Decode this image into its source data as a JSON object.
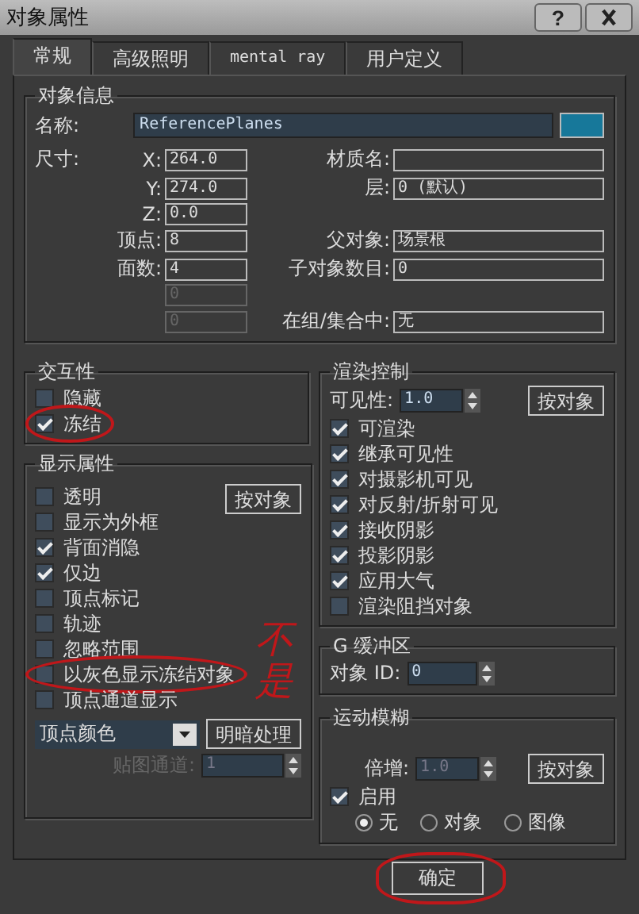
{
  "window": {
    "title": "对象属性",
    "help_button": "?"
  },
  "tabs": [
    {
      "label": "常规",
      "selected": true
    },
    {
      "label": "高级照明",
      "selected": false
    },
    {
      "label": "mental ray",
      "selected": false
    },
    {
      "label": "用户定义",
      "selected": false
    }
  ],
  "object_info": {
    "title": "对象信息",
    "name_label": "名称:",
    "name_value": "ReferencePlanes",
    "size_label": "尺寸:",
    "rows": [
      {
        "left": {
          "label": "X:",
          "value": "264.0"
        },
        "right": {
          "label": "材质名:"
        }
      },
      {
        "left": {
          "label": "Y:",
          "value": "274.0"
        },
        "right": {
          "label": "层:",
          "value": "0 (默认)"
        }
      },
      {
        "left": {
          "label": "Z:",
          "value": "0.0"
        }
      },
      {
        "left": {
          "label": "顶点:",
          "value": "8"
        },
        "right": {
          "label": "父对象:",
          "value": "场景根"
        }
      },
      {
        "left": {
          "label": "面数:",
          "value": "4"
        },
        "right": {
          "label": "子对象数目:",
          "value": "0"
        }
      },
      {
        "left": {
          "value": "0",
          "disabled": true
        }
      },
      {
        "left": {
          "value": "0",
          "disabled": true
        },
        "right": {
          "label": "在组/集合中:",
          "value": "无"
        }
      }
    ]
  },
  "interactivity": {
    "title": "交互性",
    "items": [
      {
        "label": "隐藏",
        "checked": false,
        "circled": false
      },
      {
        "label": "冻结",
        "checked": true,
        "circled": true
      }
    ]
  },
  "display_properties": {
    "title": "显示属性",
    "button": "按对象",
    "items": [
      {
        "label": "透明",
        "checked": false,
        "circled": false
      },
      {
        "label": "显示为外框",
        "checked": false,
        "circled": false
      },
      {
        "label": "背面消隐",
        "checked": true,
        "circled": false
      },
      {
        "label": "仅边",
        "checked": true,
        "circled": false
      },
      {
        "label": "顶点标记",
        "checked": false,
        "circled": false
      },
      {
        "label": "轨迹",
        "checked": false,
        "circled": false
      },
      {
        "label": "忽略范围",
        "checked": false,
        "circled": false
      },
      {
        "label": "以灰色显示冻结对象",
        "checked": false,
        "circled": true
      },
      {
        "label": "顶点通道显示",
        "checked": false,
        "circled": false
      }
    ],
    "dropdown": "顶点颜色",
    "shading_button": "明暗处理",
    "map_channel_label": "贴图通道:",
    "map_channel_value": "1"
  },
  "render_control": {
    "title": "渲染控制",
    "visibility_label": "可见性:",
    "visibility_value": "1.0",
    "button": "按对象",
    "items": [
      {
        "label": "可渲染",
        "checked": true
      },
      {
        "label": "继承可见性",
        "checked": true
      },
      {
        "label": "对摄影机可见",
        "checked": true
      },
      {
        "label": "对反射/折射可见",
        "checked": true
      },
      {
        "label": "接收阴影",
        "checked": true
      },
      {
        "label": "投影阴影",
        "checked": true
      },
      {
        "label": "应用大气",
        "checked": true
      },
      {
        "label": "渲染阻挡对象",
        "checked": false
      }
    ]
  },
  "g_buffer": {
    "title": "G 缓冲区",
    "label": "对象 ID:",
    "value": "0"
  },
  "motion_blur": {
    "title": "运动模糊",
    "multiplier_label": "倍增:",
    "multiplier_value": "1.0",
    "button": "按对象",
    "enable_label": "启用",
    "enabled": true,
    "radios": [
      {
        "label": "无",
        "selected": true
      },
      {
        "label": "对象",
        "selected": false
      },
      {
        "label": "图像",
        "selected": false
      }
    ]
  },
  "ok_button": {
    "label": "确定",
    "circled": true
  },
  "annotation": {
    "text": "不是"
  }
}
